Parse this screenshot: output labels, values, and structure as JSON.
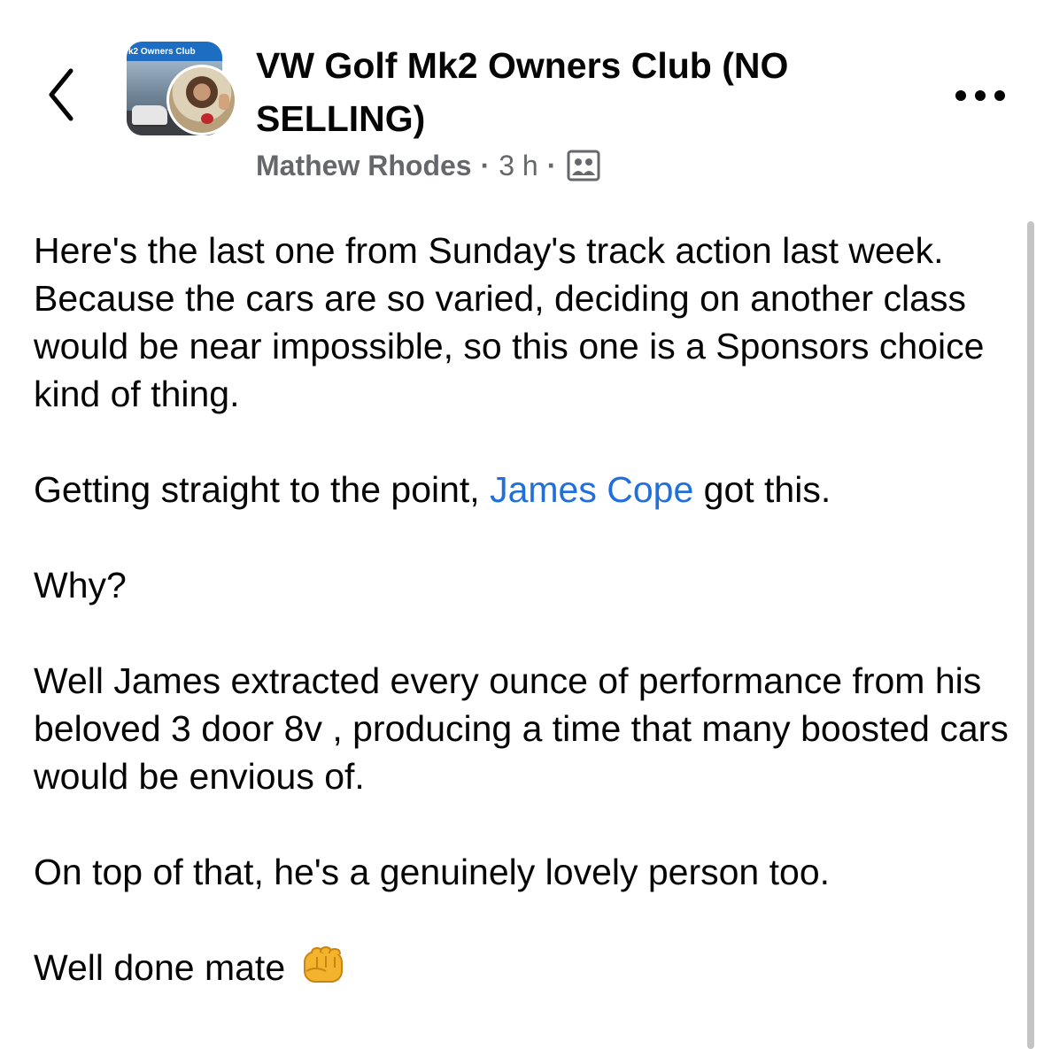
{
  "header": {
    "group_name": "VW Golf Mk2 Owners Club (NO SELLING)",
    "group_avatar_banner": "k2 Owners Club",
    "author": "Mathew Rhodes",
    "separator": "·",
    "time": "3 h",
    "audience_icon": "group-members-icon",
    "back_icon": "chevron-left-icon",
    "more_icon": "more-horizontal-icon"
  },
  "post": {
    "line1": "Here's the last one from Sunday's track action last week.",
    "line2": "Because the cars are so varied, deciding on another class would be near impossible, so this one is a Sponsors choice kind of thing.",
    "line3_before": "Getting straight to the point, ",
    "line3_mention": "James Cope",
    "line3_after": " got this.",
    "line4": "Why?",
    "line5": "Well James extracted every ounce of performance from his beloved 3 door 8v , producing a time that many boosted cars would be envious of.",
    "line6": "On top of that, he's a genuinely lovely person too.",
    "line7": "Well done mate",
    "line7_emoji": "oncoming-fist-emoji"
  },
  "colors": {
    "text": "#050505",
    "secondary_text": "#65676b",
    "link": "#216fdb"
  }
}
